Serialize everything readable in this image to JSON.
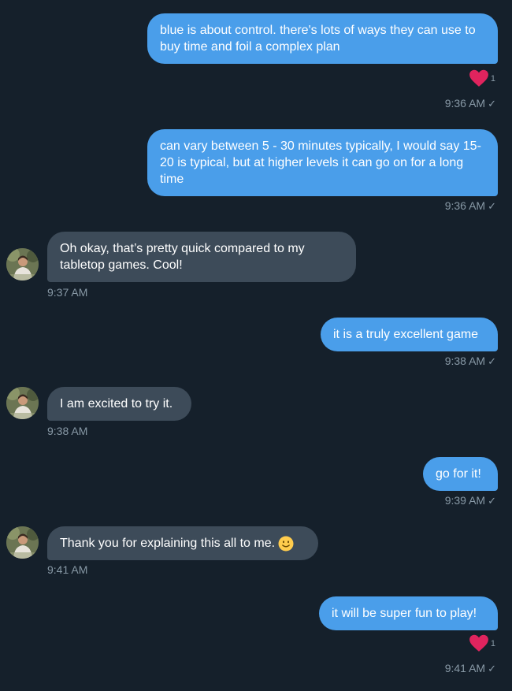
{
  "messages": [
    {
      "text": "blue is about control. there's lots of ways they can use to buy time and foil a complex plan",
      "time": "9:36 AM",
      "reaction_count": "1"
    },
    {
      "text": "can vary between 5 - 30 minutes typically, I would say 15-20 is typical, but at higher levels it can go on for a long time",
      "time": "9:36 AM"
    },
    {
      "text": "Oh okay, that’s pretty quick compared to my tabletop games. Cool!",
      "time": "9:37 AM"
    },
    {
      "text": "it is a truly excellent game",
      "time": "9:38 AM"
    },
    {
      "text": "I am excited to try it.",
      "time": "9:38 AM"
    },
    {
      "text": "go for it!",
      "time": "9:39 AM"
    },
    {
      "text": "Thank you for explaining this all to me.",
      "time": "9:41 AM"
    },
    {
      "text": "it will be super fun to play!",
      "time": "9:41 AM",
      "reaction_count": "1"
    }
  ],
  "sent_check": "✓",
  "colors": {
    "background": "#15202b",
    "outgoing_bubble": "#4a9eea",
    "incoming_bubble": "#3d4b59",
    "timestamp": "#8899a6",
    "heart": "#e0245e"
  }
}
